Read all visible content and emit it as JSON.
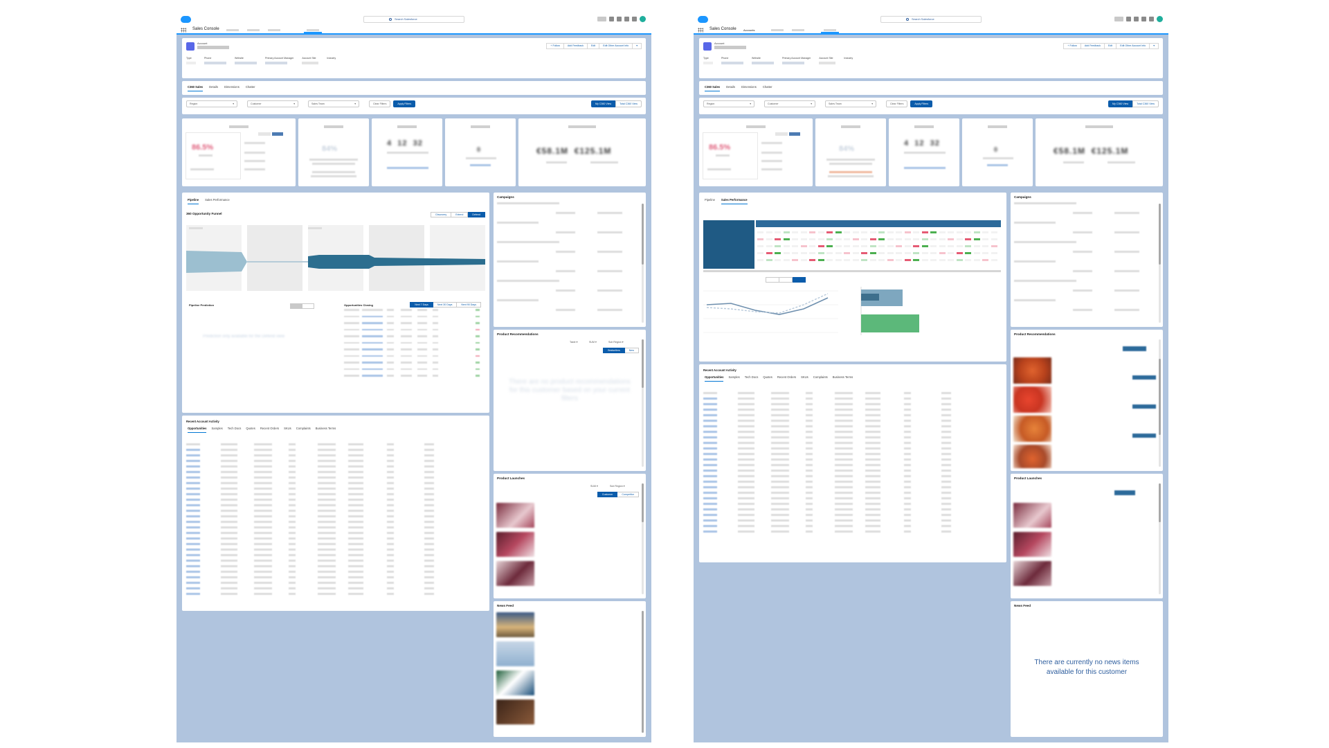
{
  "app": {
    "name": "Sales Console",
    "search_placeholder": "Search Salesforce"
  },
  "nav": {
    "right_tabs": [
      "Accounts"
    ]
  },
  "highlights": {
    "object_label": "Account",
    "actions": [
      "+ Follow",
      "Add Feedback",
      "Edit",
      "Edit Other Account Info",
      "▾"
    ],
    "fields": [
      "Type",
      "Phone",
      "Website",
      "Primary Account Manager",
      "Account Site",
      "Industry"
    ]
  },
  "record_tabs": [
    "C360 Sales",
    "Details",
    "Dimensions",
    "Chatter"
  ],
  "filters": {
    "selects": [
      "Region",
      "Customer",
      "Sales Team"
    ],
    "clear_label": "Clear Filters",
    "apply_label": "Apply Filters",
    "view_buttons": [
      "My C360 View",
      "Total C360 View"
    ]
  },
  "pipeline": {
    "tabs": [
      "Pipeline",
      "Sales Performance"
    ],
    "funnel_title": "360 Opportunity Funnel",
    "funnel_modes": [
      "Discovery",
      "Extend",
      "Defend"
    ],
    "prediction_title": "Pipeline Prediction",
    "closing_title": "Opportunities Closing",
    "closing_ranges": [
      "Next 7 Days",
      "Next 30 Days",
      "Next 90 Days"
    ]
  },
  "recent_activity": {
    "title": "Recent Account Activity",
    "tabs": [
      "Opportunities",
      "Samples",
      "Tech Docs",
      "Quotes",
      "Recent Orders",
      "SKUs",
      "Complaints",
      "Business Terms"
    ]
  },
  "right_column": {
    "campaigns_title": "Campaigns",
    "recommendations_title": "Product Recommendations",
    "rec_dropdowns": [
      "Taste",
      "SUM",
      "Sub Region"
    ],
    "rec_toggle": [
      "Bestsellers",
      "New"
    ],
    "launches_title": "Product Launches",
    "launch_dropdowns": [
      "SUM",
      "Sub Region"
    ],
    "launch_toggle": [
      "Customer",
      "Competitor"
    ],
    "news_title": "News Feed",
    "no_news": "There are currently no news items available for this customer"
  },
  "colors": {
    "brand_blue": "#0b5cab",
    "accent_blue": "#1b96ff",
    "background": "#b0c4de",
    "negative": "#e0607d",
    "positive": "#4caf50"
  }
}
